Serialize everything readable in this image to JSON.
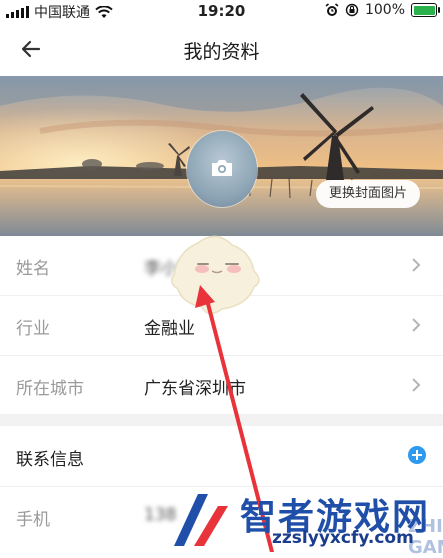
{
  "status_bar": {
    "carrier": "中国联通",
    "time": "19:20",
    "battery": "100%"
  },
  "header": {
    "back_icon": "arrow-left-icon",
    "title": "我的资料"
  },
  "cover": {
    "avatar_icon": "camera-icon",
    "change_cover_label": "更换封面图片"
  },
  "profile": {
    "rows": [
      {
        "label": "姓名",
        "value": "李小明"
      },
      {
        "label": "行业",
        "value": "金融业"
      },
      {
        "label": "所在城市",
        "value": "广东省深圳市"
      }
    ]
  },
  "contact": {
    "title": "联系信息",
    "add_icon": "plus-circle-icon",
    "rows": [
      {
        "label": "手机",
        "value": "138"
      }
    ]
  },
  "watermark": {
    "name": "智者游戏网",
    "sub": "ZHIZHE GAME",
    "url": "zzslyyxcfy.com"
  },
  "colors": {
    "accent": "#2d9af0",
    "arrow": "#e8333a",
    "battery": "#2bb24c"
  }
}
